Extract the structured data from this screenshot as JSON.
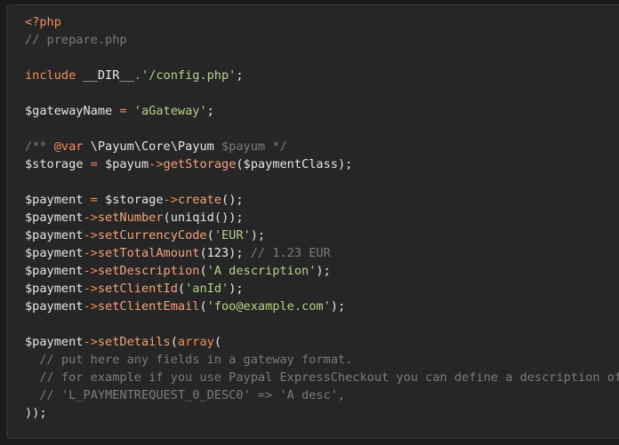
{
  "editor": {
    "language": "php",
    "colors": {
      "background": "#262626",
      "text": "#e6e6e6",
      "comment": "#7b7b7b",
      "keyword": "#f08c5a",
      "string": "#b5d38a",
      "method": "#f5a37b"
    },
    "lines": [
      [
        {
          "t": "tag",
          "v": "<?php"
        }
      ],
      [
        {
          "t": "comment",
          "v": "// prepare.php"
        }
      ],
      [],
      [
        {
          "t": "keyword",
          "v": "include"
        },
        {
          "t": "default",
          "v": " __DIR__"
        },
        {
          "t": "operator",
          "v": "."
        },
        {
          "t": "string",
          "v": "'/config.php'"
        },
        {
          "t": "default",
          "v": ";"
        }
      ],
      [],
      [
        {
          "t": "default",
          "v": "$gatewayName "
        },
        {
          "t": "operator",
          "v": "="
        },
        {
          "t": "default",
          "v": " "
        },
        {
          "t": "string",
          "v": "'aGateway'"
        },
        {
          "t": "default",
          "v": ";"
        }
      ],
      [],
      [
        {
          "t": "comment",
          "v": "/** "
        },
        {
          "t": "doctag",
          "v": "@var"
        },
        {
          "t": "default",
          "v": " \\Payum\\Core\\Payum "
        },
        {
          "t": "docvar",
          "v": "$payum */"
        }
      ],
      [
        {
          "t": "default",
          "v": "$storage "
        },
        {
          "t": "operator",
          "v": "="
        },
        {
          "t": "default",
          "v": " $payum"
        },
        {
          "t": "operator",
          "v": "->"
        },
        {
          "t": "function",
          "v": "getStorage"
        },
        {
          "t": "default",
          "v": "($paymentClass);"
        }
      ],
      [],
      [
        {
          "t": "default",
          "v": "$payment "
        },
        {
          "t": "operator",
          "v": "="
        },
        {
          "t": "default",
          "v": " $storage"
        },
        {
          "t": "operator",
          "v": "->"
        },
        {
          "t": "function",
          "v": "create"
        },
        {
          "t": "default",
          "v": "();"
        }
      ],
      [
        {
          "t": "default",
          "v": "$payment"
        },
        {
          "t": "operator",
          "v": "->"
        },
        {
          "t": "function",
          "v": "setNumber"
        },
        {
          "t": "default",
          "v": "(uniqid());"
        }
      ],
      [
        {
          "t": "default",
          "v": "$payment"
        },
        {
          "t": "operator",
          "v": "->"
        },
        {
          "t": "function",
          "v": "setCurrencyCode"
        },
        {
          "t": "default",
          "v": "("
        },
        {
          "t": "string",
          "v": "'EUR'"
        },
        {
          "t": "default",
          "v": ");"
        }
      ],
      [
        {
          "t": "default",
          "v": "$payment"
        },
        {
          "t": "operator",
          "v": "->"
        },
        {
          "t": "function",
          "v": "setTotalAmount"
        },
        {
          "t": "default",
          "v": "(123); "
        },
        {
          "t": "comment",
          "v": "// 1.23 EUR"
        }
      ],
      [
        {
          "t": "default",
          "v": "$payment"
        },
        {
          "t": "operator",
          "v": "->"
        },
        {
          "t": "function",
          "v": "setDescription"
        },
        {
          "t": "default",
          "v": "("
        },
        {
          "t": "string",
          "v": "'A description'"
        },
        {
          "t": "default",
          "v": ");"
        }
      ],
      [
        {
          "t": "default",
          "v": "$payment"
        },
        {
          "t": "operator",
          "v": "->"
        },
        {
          "t": "function",
          "v": "setClientId"
        },
        {
          "t": "default",
          "v": "("
        },
        {
          "t": "string",
          "v": "'anId'"
        },
        {
          "t": "default",
          "v": ");"
        }
      ],
      [
        {
          "t": "default",
          "v": "$payment"
        },
        {
          "t": "operator",
          "v": "->"
        },
        {
          "t": "function",
          "v": "setClientEmail"
        },
        {
          "t": "default",
          "v": "("
        },
        {
          "t": "string",
          "v": "'foo@example.com'"
        },
        {
          "t": "default",
          "v": ");"
        }
      ],
      [],
      [
        {
          "t": "default",
          "v": "$payment"
        },
        {
          "t": "operator",
          "v": "->"
        },
        {
          "t": "function",
          "v": "setDetails"
        },
        {
          "t": "default",
          "v": "("
        },
        {
          "t": "keyword",
          "v": "array"
        },
        {
          "t": "default",
          "v": "("
        }
      ],
      [
        {
          "t": "comment",
          "v": "  // put here any fields in a gateway format."
        }
      ],
      [
        {
          "t": "comment",
          "v": "  // for example if you use Paypal ExpressCheckout you can define a description of the first item:"
        }
      ],
      [
        {
          "t": "comment",
          "v": "  // 'L_PAYMENTREQUEST_0_DESC0' => 'A desc',"
        }
      ],
      [
        {
          "t": "default",
          "v": "));"
        }
      ]
    ]
  }
}
